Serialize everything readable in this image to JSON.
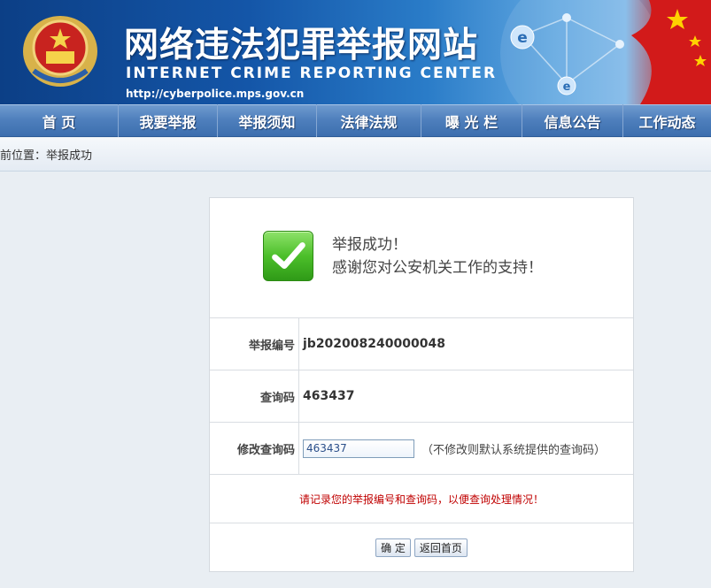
{
  "banner": {
    "title_cn": "网络违法犯罪举报网站",
    "title_en": "INTERNET CRIME REPORTING CENTER",
    "url": "http://cyberpolice.mps.gov.cn"
  },
  "nav": {
    "items": [
      "首  页",
      "我要举报",
      "举报须知",
      "法律法规",
      "曝 光 栏",
      "信息公告",
      "工作动态"
    ]
  },
  "breadcrumb": {
    "text": "当前位置：举报成功"
  },
  "success": {
    "line1": "举报成功！",
    "line2": "感谢您对公安机关工作的支持！"
  },
  "rows": {
    "report_no_label": "举报编号",
    "report_no_value": "jb202008240000048",
    "query_code_label": "查询码",
    "query_code_value": "463437",
    "modify_label": "修改查询码",
    "modify_input_value": "463437",
    "modify_hint": "（不修改则默认系统提供的查询码）"
  },
  "notice": "请记录您的举报编号和查询码，以便查询处理情况！",
  "buttons": {
    "confirm": "确 定",
    "back": "返回首页"
  },
  "colors": {
    "nav": "#4f80bd",
    "notice": "#c00000",
    "check": "#4cbf2a"
  }
}
